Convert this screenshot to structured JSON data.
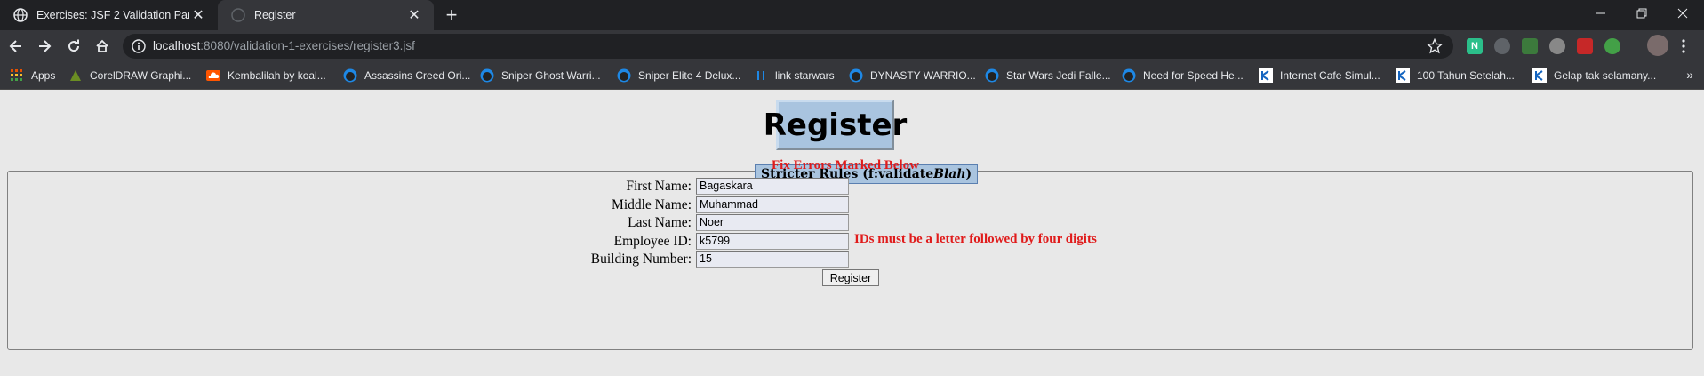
{
  "browser": {
    "tabs": [
      {
        "title": "Exercises: JSF 2 Validation Part 1",
        "active": false
      },
      {
        "title": "Register",
        "active": true
      }
    ],
    "url": {
      "host": "localhost",
      "rest": ":8080/validation-1-exercises/register3.jsf"
    },
    "bookmarks": [
      {
        "label": "Apps",
        "icon": "apps-grid-icon"
      },
      {
        "label": "CorelDRAW Graphi...",
        "icon": "coreldraw-icon"
      },
      {
        "label": "Kembalilah by koal...",
        "icon": "soundcloud-icon"
      },
      {
        "label": "Assassins Creed Ori...",
        "icon": "game-site-icon"
      },
      {
        "label": "Sniper Ghost Warri...",
        "icon": "game-site-icon"
      },
      {
        "label": "Sniper Elite 4 Delux...",
        "icon": "game-site-icon"
      },
      {
        "label": "link starwars",
        "icon": "link-icon"
      },
      {
        "label": "DYNASTY WARRIO...",
        "icon": "game-site-icon"
      },
      {
        "label": "Star Wars Jedi Falle...",
        "icon": "game-site-icon"
      },
      {
        "label": "Need for Speed He...",
        "icon": "game-site-icon"
      },
      {
        "label": "Internet Cafe Simul...",
        "icon": "k-site-icon"
      },
      {
        "label": "100 Tahun Setelah...",
        "icon": "k-site-icon"
      },
      {
        "label": "Gelap tak selamany...",
        "icon": "k-site-icon"
      }
    ]
  },
  "page": {
    "heading": "Register",
    "legend": {
      "prefix": "Stricter Rules (f:validate",
      "italic": "Blah",
      "suffix": ")"
    },
    "error_summary": "Fix Errors Marked Below",
    "fields": [
      {
        "label": "First Name:",
        "value": "Bagaskara"
      },
      {
        "label": "Middle Name:",
        "value": "Muhammad"
      },
      {
        "label": "Last Name:",
        "value": "Noer"
      },
      {
        "label": "Employee ID:",
        "value": "k5799"
      },
      {
        "label": "Building Number:",
        "value": "15"
      }
    ],
    "employee_id_error": "IDs must be a letter followed by four digits",
    "submit_label": "Register"
  },
  "colors": {
    "error": "#e01b1b",
    "heading_bg": "#a9c4df",
    "page_bg": "#e8e8e8"
  }
}
